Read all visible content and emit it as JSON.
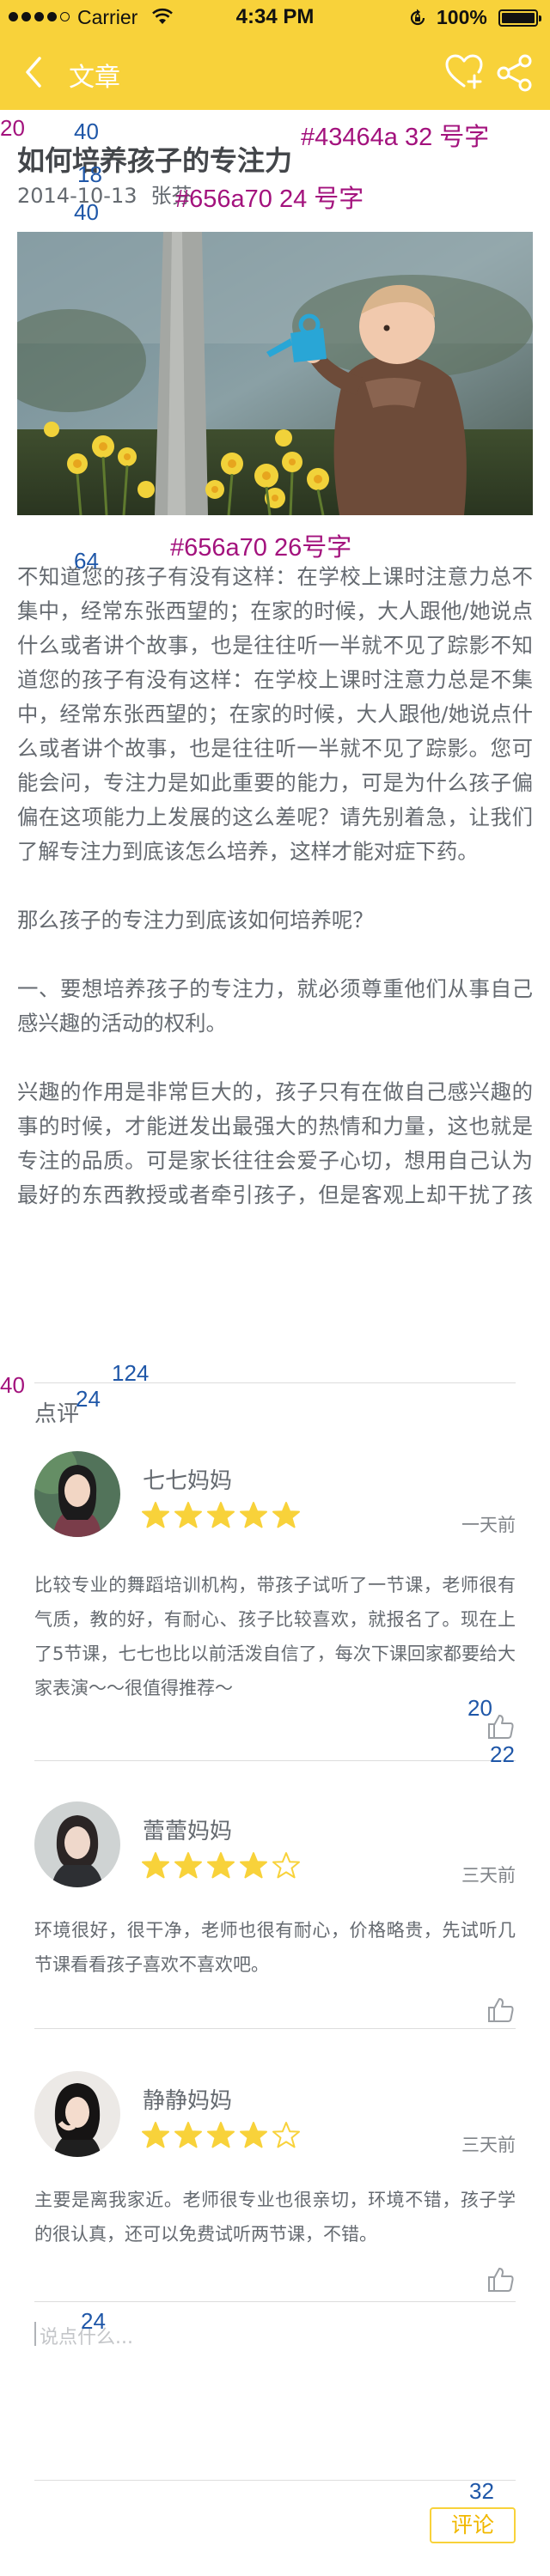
{
  "status_bar": {
    "carrier": "Carrier",
    "time": "4:34 PM",
    "battery": "100%"
  },
  "nav": {
    "title": "文章",
    "back_icon": "chevron-left-icon",
    "favorite_icon": "heart-plus-icon",
    "share_icon": "share-icon",
    "bar_color": "#f8d23a"
  },
  "article": {
    "title": "如何培养孩子的专注力",
    "date": "2014-10-13",
    "author": "张芬",
    "image": "child-watering-daffodils-photo",
    "paragraphs": [
      "不知道您的孩子有没有这样：在学校上课时注意力总不集中，经常东张西望的；在家的时候，大人跟他/她说点什么或者讲个故事，也是往往听一半就不见了踪影不知道您的孩子有没有这样：在学校上课时注意力总是不集中，经常东张西望的；在家的时候，大人跟他/她说点什么或者讲个故事，也是往往听一半就不见了踪影。您可能会问，专注力是如此重要的能力，可是为什么孩子偏偏在这项能力上发展的这么差呢？请先别着急，让我们了解专注力到底该怎么培养，这样才能对症下药。",
      "那么孩子的专注力到底该如何培养呢？",
      "一、要想培养孩子的专注力，就必须尊重他们从事自己感兴趣的活动的权利。",
      "兴趣的作用是非常巨大的，孩子只有在做自己感兴趣的事的时候，才能迸发出最强大的热情和力量，这也就是专注的品质。可是家长往往会爱子心切，想用自己认为最好的东西教授或者牵引孩子，但是客观上却干扰了孩子自主选择的权利，没有尊重孩"
    ]
  },
  "comments": {
    "section_title": "点评",
    "items": [
      {
        "name": "七七妈妈",
        "rating": 5,
        "time": "一天前",
        "text": "比较专业的舞蹈培训机构，带孩子试听了一节课，老师很有气质，教的好，有耐心、孩子比较喜欢，就报名了。现在上了5节课，七七也比以前活泼自信了，每次下课回家都要给大家表演～～很值得推荐～"
      },
      {
        "name": "蕾蕾妈妈",
        "rating": 4,
        "time": "三天前",
        "text": "环境很好，很干净，老师也很有耐心，价格略贵，先试听几节课看看孩子喜欢不喜欢吧。"
      },
      {
        "name": "静静妈妈",
        "rating": 4,
        "time": "三天前",
        "text": "主要是离我家近。老师很专业也很亲切，环境不错，孩子学的很认真，还可以免费试听两节课，不错。"
      }
    ],
    "input_placeholder": "说点什么...",
    "submit_label": "评论"
  },
  "colors": {
    "accent": "#f8d23a",
    "title_text": "#43464a",
    "body_text": "#656a70",
    "star": "#f8d23a"
  },
  "annotations": {
    "title_spec": "#43464a  32 号字",
    "meta_spec": "#656a70  24 号字",
    "body_spec": "#656a70  26号字",
    "n20": "20",
    "n40": "40",
    "n18": "18",
    "n40b": "40",
    "n64": "64",
    "n40c": "40",
    "n124": "124",
    "n24": "24",
    "n20b": "20",
    "n22": "22",
    "n24b": "24",
    "n32": "32"
  }
}
